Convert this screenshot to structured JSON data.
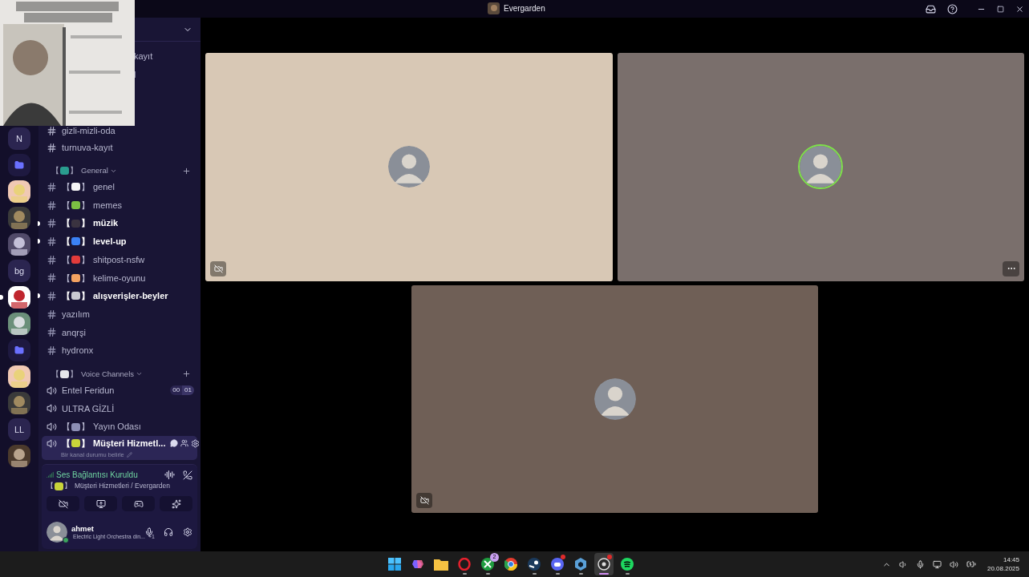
{
  "window": {
    "title": "Evergarden"
  },
  "webcam_overlay": {
    "kind": "picture"
  },
  "server_rail": [
    {
      "kind": "letter",
      "label": "N",
      "unread": false
    },
    {
      "kind": "folder",
      "unread": false
    },
    {
      "kind": "picture",
      "unread": false
    },
    {
      "kind": "picture",
      "unread": false
    },
    {
      "kind": "picture",
      "unread": false
    },
    {
      "kind": "letter",
      "label": "bg",
      "unread": false
    },
    {
      "kind": "picture",
      "unread": true
    },
    {
      "kind": "picture",
      "unread": false
    },
    {
      "kind": "folder",
      "unread": false
    },
    {
      "kind": "picture",
      "unread": false
    },
    {
      "kind": "picture",
      "unread": false
    },
    {
      "kind": "letter",
      "label": "LL",
      "unread": false
    },
    {
      "kind": "picture",
      "unread": false
    }
  ],
  "top_channels": [
    {
      "kind": "clipped",
      "name": "kayıt"
    },
    {
      "kind": "clipped",
      "name": "l"
    },
    {
      "kind": "text",
      "name": "gizli-mizli-oda"
    },
    {
      "kind": "text",
      "name": "turnuva-kayıt"
    }
  ],
  "categories": [
    {
      "name": "General",
      "brackets": [
        "【",
        "】"
      ],
      "color": "#2a9d8f",
      "expanded": true,
      "channels": [
        {
          "kind": "text",
          "name": "genel",
          "brackets": [
            "【",
            "】"
          ],
          "color": "#f5f5f5",
          "unread": false,
          "selected": false
        },
        {
          "kind": "text",
          "name": "memes",
          "brackets": [
            "【",
            "】"
          ],
          "color": "#7bc043",
          "unread": false,
          "selected": false
        },
        {
          "kind": "text",
          "name": "müzik",
          "brackets": [
            "【",
            "】"
          ],
          "color": "#3a3340",
          "unread": true,
          "selected": false
        },
        {
          "kind": "text",
          "name": "level-up",
          "brackets": [
            "【",
            "】"
          ],
          "color": "#3b82f6",
          "unread": true,
          "selected": false
        },
        {
          "kind": "text",
          "name": "shitpost-nsfw",
          "brackets": [
            "【",
            "】"
          ],
          "color": "#e23b3b",
          "unread": false,
          "selected": false
        },
        {
          "kind": "text",
          "name": "kelime-oyunu",
          "brackets": [
            "【",
            "】"
          ],
          "color": "#f4a261",
          "unread": false,
          "selected": false
        },
        {
          "kind": "text",
          "name": "alışverişler-beyler",
          "brackets": [
            "【",
            "】"
          ],
          "color": "#c9c9d1",
          "unread": true,
          "selected": false
        },
        {
          "kind": "text",
          "name": "yazılım",
          "unread": false,
          "selected": false
        },
        {
          "kind": "text",
          "name": "anqrşi",
          "unread": false,
          "selected": false
        },
        {
          "kind": "text",
          "name": "hydronx",
          "unread": false,
          "selected": false
        }
      ]
    },
    {
      "name": "Voice Channels",
      "brackets": [
        "【",
        "】"
      ],
      "color": "#e5e5ea",
      "expanded": true,
      "channels": [
        {
          "kind": "voice",
          "name": "Entel Feridun",
          "counters": [
            "00",
            "01"
          ],
          "selected": false
        },
        {
          "kind": "voice",
          "name": "ULTRA GİZLİ",
          "selected": false
        },
        {
          "kind": "voice",
          "name": "Yayın Odası",
          "brackets": [
            "【",
            "】"
          ],
          "color": "#8d8fb5",
          "selected": false
        },
        {
          "kind": "voice",
          "name": "Müşteri Hizmetl...",
          "brackets": [
            "【",
            "】"
          ],
          "color": "#c8d43a",
          "selected": true,
          "status": "Bir kanal durumu belirle"
        }
      ]
    }
  ],
  "voice_panel": {
    "status": "Ses Bağlantısı Kuruldu",
    "brackets": [
      "【",
      "】"
    ],
    "color": "#c8d43a",
    "channel": "Müşteri Hizmetleri / Evergarden"
  },
  "user": {
    "name": "ahmet",
    "activity": "Electric Light Orchestra din...",
    "extra": "+1",
    "online": true
  },
  "tiles": [
    {
      "color": "#d8c8b5",
      "speaking": false,
      "camera_off": true,
      "more": false
    },
    {
      "color": "#7a6f6c",
      "speaking": true,
      "camera_off": false,
      "more": true
    },
    {
      "color": "#6f5f56",
      "speaking": false,
      "camera_off": true,
      "more": false
    }
  ],
  "taskbar": {
    "apps": [
      {
        "kind": "grid",
        "running": false,
        "active": false
      },
      {
        "kind": "blob",
        "running": false,
        "active": false
      },
      {
        "kind": "folder",
        "running": false,
        "active": false
      },
      {
        "kind": "ring",
        "running": true,
        "active": false
      },
      {
        "kind": "xcircle",
        "running": true,
        "active": false,
        "badge": "2"
      },
      {
        "kind": "wheel",
        "running": false,
        "active": false
      },
      {
        "kind": "steam",
        "running": true,
        "active": false
      },
      {
        "kind": "chat",
        "running": true,
        "active": false,
        "alert": true
      },
      {
        "kind": "cube",
        "running": true,
        "active": false
      },
      {
        "kind": "camera",
        "running": true,
        "active": true,
        "alert": true
      },
      {
        "kind": "waves",
        "running": true,
        "active": false
      }
    ],
    "time": "14:45",
    "date": "20.08.2025"
  }
}
